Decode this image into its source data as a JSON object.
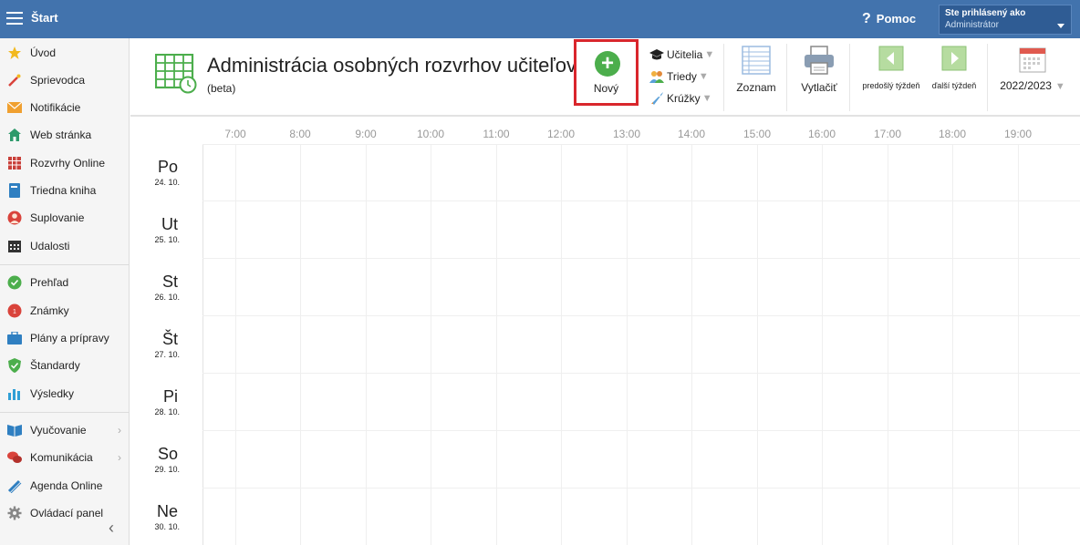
{
  "topbar": {
    "start_label": "Štart",
    "help_label": "Pomoc",
    "help_icon": "?",
    "user_line1": "Ste prihlásený ako",
    "user_line2": "Administrátor",
    "bg_color": "#4273ad"
  },
  "sidebar": {
    "items": [
      {
        "label": "Úvod",
        "icon": "star-icon"
      },
      {
        "label": "Sprievodca",
        "icon": "magic-wand-icon"
      },
      {
        "label": "Notifikácie",
        "icon": "envelope-icon"
      },
      {
        "label": "Web stránka",
        "icon": "house-icon"
      },
      {
        "label": "Rozvrhy Online",
        "icon": "timetable-icon"
      },
      {
        "label": "Triedna kniha",
        "icon": "book-icon"
      },
      {
        "label": "Suplovanie",
        "icon": "person-icon"
      },
      {
        "label": "Udalosti",
        "icon": "calendar-icon"
      },
      {
        "label": "Prehľad",
        "icon": "check-circle-icon"
      },
      {
        "label": "Známky",
        "icon": "grades-icon"
      },
      {
        "label": "Plány a prípravy",
        "icon": "briefcase-icon"
      },
      {
        "label": "Štandardy",
        "icon": "shield-check-icon"
      },
      {
        "label": "Výsledky",
        "icon": "bar-chart-icon"
      },
      {
        "label": "Vyučovanie",
        "icon": "open-book-icon"
      },
      {
        "label": "Komunikácia",
        "icon": "chat-icon"
      },
      {
        "label": "Agenda Online",
        "icon": "pencil-icon"
      },
      {
        "label": "Ovládací panel",
        "icon": "gear-icon"
      }
    ]
  },
  "header": {
    "title": "Administrácia osobných rozvrhov učiteľov",
    "subtitle": "(beta)",
    "new_label": "Nový",
    "filters": {
      "teachers": "Učitelia",
      "classes": "Triedy",
      "clubs": "Krúžky"
    },
    "list_label": "Zoznam",
    "print_label": "Vytlačiť",
    "prev_week_label": "predošlý týždeň",
    "next_week_label": "ďalší týždeň",
    "year_label": "2022/2023",
    "accent_red": "#d9262c",
    "accent_green": "#4cae4c"
  },
  "schedule": {
    "hours": [
      "7:00",
      "8:00",
      "9:00",
      "10:00",
      "11:00",
      "12:00",
      "13:00",
      "14:00",
      "15:00",
      "16:00",
      "17:00",
      "18:00",
      "19:00"
    ],
    "days": [
      {
        "name": "Po",
        "date": "24. 10."
      },
      {
        "name": "Ut",
        "date": "25. 10."
      },
      {
        "name": "St",
        "date": "26. 10."
      },
      {
        "name": "Št",
        "date": "27. 10."
      },
      {
        "name": "Pi",
        "date": "28. 10."
      },
      {
        "name": "So",
        "date": "29. 10."
      },
      {
        "name": "Ne",
        "date": "30. 10."
      }
    ]
  }
}
